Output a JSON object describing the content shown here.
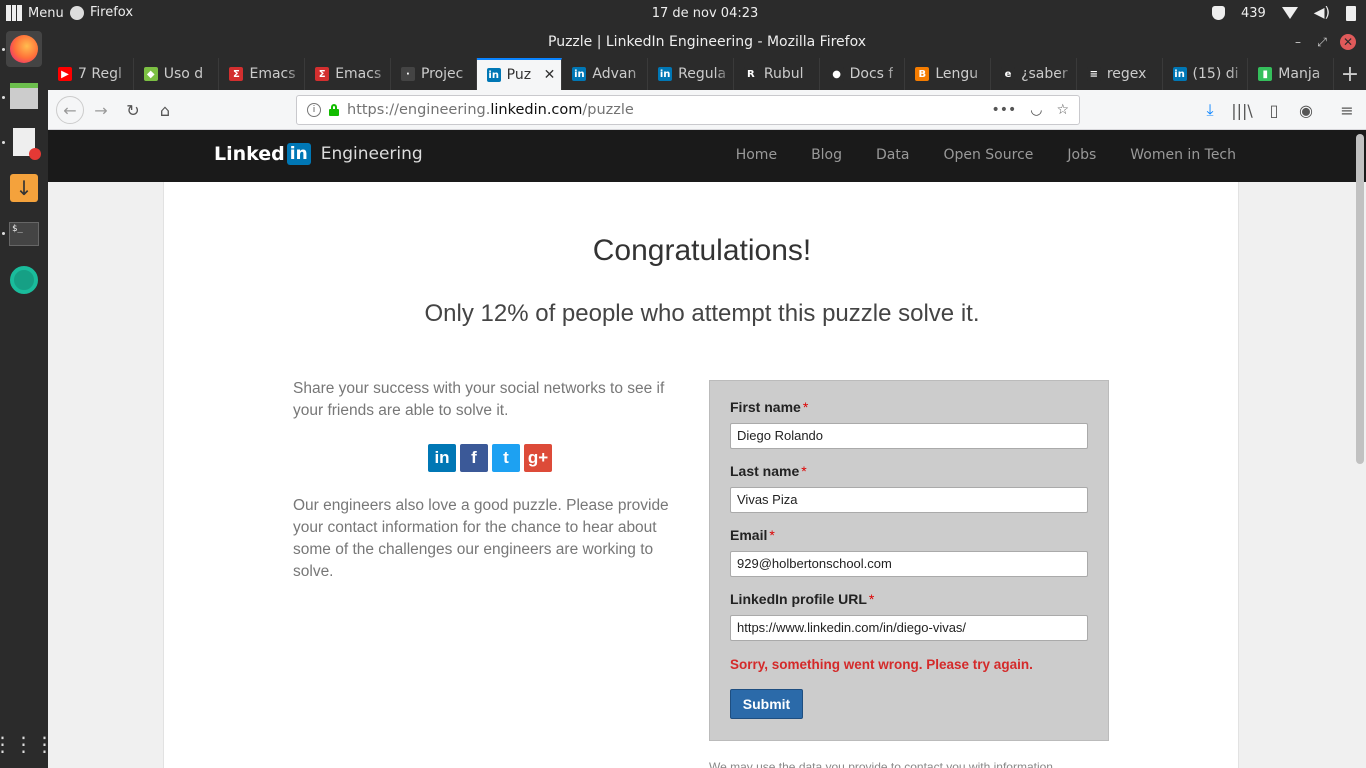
{
  "system": {
    "menu_label": "Menu",
    "app_label": "Firefox",
    "clock": "17 de nov  04:23",
    "tray_count": "439"
  },
  "window": {
    "title": "Puzzle | LinkedIn Engineering - Mozilla Firefox"
  },
  "tabs": [
    {
      "label": "7 Regl",
      "favicon_color": "#ff0000",
      "glyph": "▶"
    },
    {
      "label": "Uso d",
      "favicon_color": "#7cc043",
      "glyph": "◆"
    },
    {
      "label": "Emacs",
      "favicon_color": "#d32f2f",
      "glyph": "Σ"
    },
    {
      "label": "Emacs",
      "favicon_color": "#d32f2f",
      "glyph": "Σ"
    },
    {
      "label": "Projec",
      "favicon_color": "#444444",
      "glyph": "·"
    },
    {
      "label": "Puz",
      "favicon_color": "#0077b5",
      "glyph": "in"
    },
    {
      "label": "Advan",
      "favicon_color": "#0077b5",
      "glyph": "in"
    },
    {
      "label": "Regula",
      "favicon_color": "#0077b5",
      "glyph": "in"
    },
    {
      "label": "Rubul",
      "favicon_color": "#2b2b2b",
      "glyph": "R"
    },
    {
      "label": "Docs f",
      "favicon_color": "#2b2b2b",
      "glyph": "●"
    },
    {
      "label": "Lengu",
      "favicon_color": "#f57c00",
      "glyph": "B"
    },
    {
      "label": "¿saber",
      "favicon_color": "#2b2b2b",
      "glyph": "e"
    },
    {
      "label": "regex",
      "favicon_color": "#2b2b2b",
      "glyph": "≡"
    },
    {
      "label": "(15) di",
      "favicon_color": "#0077b5",
      "glyph": "in"
    },
    {
      "label": "Manja",
      "favicon_color": "#35bf5c",
      "glyph": "▮"
    }
  ],
  "active_tab_index": 5,
  "url": {
    "prefix": "https://engineering.",
    "domain": "linkedin.com",
    "path": "/puzzle"
  },
  "site": {
    "logo_word": "Linked",
    "logo_in": "in",
    "logo_suffix": "Engineering",
    "nav": [
      "Home",
      "Blog",
      "Data",
      "Open Source",
      "Jobs",
      "Women in Tech"
    ]
  },
  "main": {
    "title": "Congratulations!",
    "subtitle": "Only 12% of people who attempt this puzzle solve it.",
    "share_text": "Share your success with your social networks to see if your friends are able to solve it.",
    "puzzle_text": "Our engineers also love a good puzzle. Please provide your contact information for the chance to hear about some of the challenges our engineers are working to solve.",
    "social": [
      {
        "name": "linkedin",
        "glyph": "in",
        "color": "#0077b5"
      },
      {
        "name": "facebook",
        "glyph": "f",
        "color": "#3b5998"
      },
      {
        "name": "twitter",
        "glyph": "t",
        "color": "#1da1f2"
      },
      {
        "name": "google-plus",
        "glyph": "g+",
        "color": "#dd4b39"
      }
    ]
  },
  "form": {
    "first_name_label": "First name",
    "first_name_value": "Diego Rolando",
    "last_name_label": "Last name",
    "last_name_value": "Vivas Piza",
    "email_label": "Email",
    "email_value": "929@holbertonschool.com",
    "profile_label": "LinkedIn profile URL",
    "profile_value": "https://www.linkedin.com/in/diego-vivas/",
    "required_mark": "*",
    "error": "Sorry, something went wrong. Please try again.",
    "submit_label": "Submit",
    "disclaimer": "We may use the data you provide to contact you with information"
  }
}
